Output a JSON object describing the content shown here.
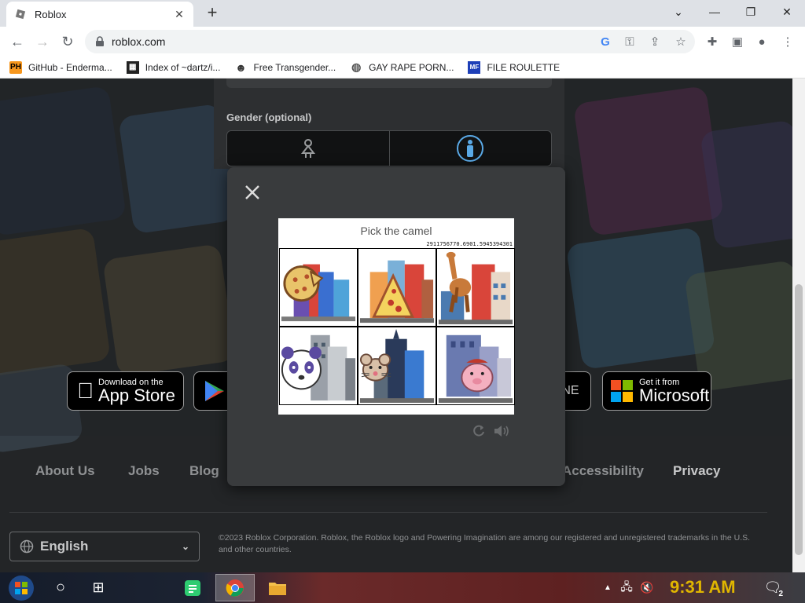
{
  "browser": {
    "tab_title": "Roblox",
    "url": "roblox.com",
    "bookmarks": [
      {
        "label": "GitHub - Enderma...",
        "icon": "ph-badge-icon"
      },
      {
        "label": "Index of ~dartz/i...",
        "icon": "grid-image-icon"
      },
      {
        "label": "Free Transgender...",
        "icon": "mask-icon"
      },
      {
        "label": "GAY RAPE PORN...",
        "icon": "globe-icon"
      },
      {
        "label": "FILE ROULETTE",
        "icon": "mf-badge-icon"
      }
    ],
    "ph_badge": "PH",
    "mf_badge": "MF"
  },
  "signup": {
    "gender_label": "Gender (optional)"
  },
  "captcha": {
    "prompt": "Pick the camel",
    "code": "2911756770.6901.5945394301",
    "tiles": [
      "pizza-building",
      "pizza-slice-building",
      "camel-building",
      "panda-building",
      "mouse-building",
      "pig-building"
    ]
  },
  "stores": {
    "apple_small": "Download on the",
    "apple_big": "App Store",
    "ms_small": "Get it from",
    "ms_big": "Microsoft",
    "partial": "NE"
  },
  "footer": {
    "links": [
      "About Us",
      "Jobs",
      "Blog",
      "Accessibility",
      "Privacy"
    ],
    "language": "English",
    "copyright": "©2023 Roblox Corporation. Roblox, the Roblox logo and Powering Imagination are among our registered and unregistered trademarks in the U.S. and other countries."
  },
  "taskbar": {
    "time": "9:31 AM",
    "notifications": "2"
  },
  "colors": {
    "page_bg": "#232527",
    "modal_bg": "#393b3d",
    "accent_blue": "#5aa9e6",
    "clock": "#e0b600"
  }
}
